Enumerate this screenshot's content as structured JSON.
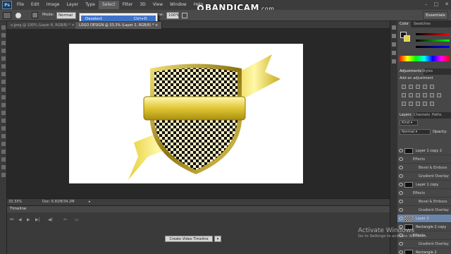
{
  "menubar": {
    "logo": "Ps",
    "items": [
      "File",
      "Edit",
      "Image",
      "Layer",
      "Type",
      "Select",
      "Filter",
      "3D",
      "View",
      "Window",
      "Help"
    ],
    "active": "Select"
  },
  "watermark": {
    "brand": "BANDICAM",
    "suffix": ".com"
  },
  "options": {
    "mode_label": "Mode:",
    "mode_value": "Normal",
    "flow_label": "Flow:",
    "flow_value": "100%",
    "workspace": "Essentials"
  },
  "dropdown": {
    "item_label": "Deselect",
    "item_shortcut": "Ctrl+D"
  },
  "tabs": [
    {
      "label": "o.jpeg @ 100% (Layer 8, RGB/8) *",
      "active": false
    },
    {
      "label": "LOGO DESIGN @ 33.3% (Layer 2, RGB/8) *",
      "active": true
    }
  ],
  "status": {
    "zoom": "33.33%",
    "doc": "Doc: 6.81M/34.2M"
  },
  "timeline": {
    "title": "Timeline",
    "create_button": "Create Video Timeline"
  },
  "panels": {
    "color_tabs": [
      "Color",
      "Swatches"
    ],
    "adjust_tabs": [
      "Adjustments",
      "Styles"
    ],
    "adjust_title": "Add an adjustment",
    "layer_tabs": [
      "Layers",
      "Channels",
      "Paths"
    ],
    "kind": "Kind",
    "blend": "Normal",
    "opacity_label": "Opacity:"
  },
  "layers": [
    {
      "name": "Layer 1 copy 2",
      "type": "layer",
      "selected": false
    },
    {
      "name": "Effects",
      "type": "effects"
    },
    {
      "name": "Bevel & Emboss",
      "type": "effect"
    },
    {
      "name": "Gradient Overlay",
      "type": "effect"
    },
    {
      "name": "Layer 1 copy",
      "type": "layer",
      "selected": false
    },
    {
      "name": "Effects",
      "type": "effects"
    },
    {
      "name": "Bevel & Emboss",
      "type": "effect"
    },
    {
      "name": "Gradient Overlay",
      "type": "effect"
    },
    {
      "name": "Layer 2",
      "type": "layer",
      "selected": true
    },
    {
      "name": "Rectangle 2 copy",
      "type": "layer",
      "selected": false
    },
    {
      "name": "Effects",
      "type": "effects"
    },
    {
      "name": "Gradient Overlay",
      "type": "effect"
    },
    {
      "name": "Rectangle 2",
      "type": "layer",
      "selected": false
    }
  ],
  "activate": {
    "line1": "Activate Windows",
    "line2": "Go to Settings to activate Windows."
  },
  "colors": {
    "gold_light": "#fff6a0",
    "gold_mid": "#d9c233",
    "gold_dark": "#6b5a08",
    "selection_blue": "#3f73c9"
  }
}
